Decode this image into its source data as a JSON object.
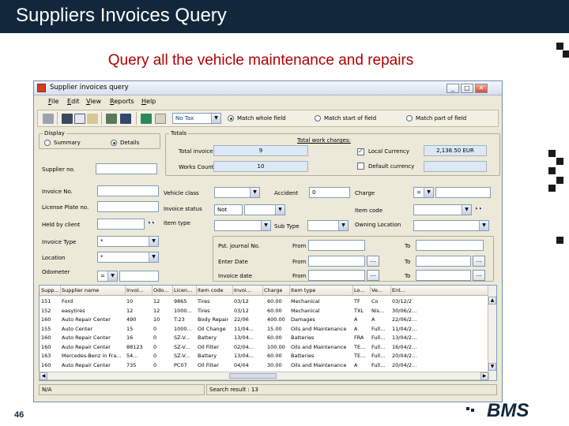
{
  "slide": {
    "title": "Suppliers Invoices Query",
    "subtitle": "Query all the vehicle maintenance and repairs",
    "page_number": "46",
    "logo_text": "BMS"
  },
  "window": {
    "title": "Supplier invoices query",
    "controls": [
      "_",
      "□",
      "✕"
    ],
    "menu": [
      "File",
      "Edit",
      "View",
      "Reports",
      "Help"
    ]
  },
  "toolbar": {
    "tax_combo": "No Tax",
    "radios": [
      {
        "label": "Match whole field",
        "checked": true
      },
      {
        "label": "Match start of field",
        "checked": false
      },
      {
        "label": "Match part of field",
        "checked": false
      }
    ]
  },
  "display": {
    "legend": "Display",
    "summary_label": "Summary",
    "detail_label": "Details",
    "selected": "Details"
  },
  "totals": {
    "legend": "Totals",
    "total_invoice_label": "Total invoice",
    "total_invoice_value": "9",
    "works_count_label": "Works Count",
    "works_count_value": "10",
    "total_work_charges_label": "Total work charges:",
    "local_currency_label": "Local Currency",
    "local_currency_checked": true,
    "local_currency_value": "2,138.50 EUR",
    "default_currency_label": "Default currency",
    "default_currency_checked": false
  },
  "filters": {
    "supplier_no": "Supplier no.",
    "invoice_no": "Invoice No.",
    "license_plate_no": "License Plate no.",
    "held_by_client": "Held by client",
    "invoice_type": "Invoice Type",
    "invoice_type_value": "*",
    "location": "Location",
    "location_value": "*",
    "odometer": "Odometer",
    "odometer_op": "=",
    "vehicle_class": "Vehicle class",
    "invoice_status": "Invoice status",
    "invoice_status_value": "Not",
    "item_type": "Item type",
    "sub_type": "Sub Type",
    "accident": "Accident",
    "accident_value": "0",
    "charge": "Charge",
    "charge_op": "=",
    "item_code": "Item code",
    "owning_location": "Owning Location",
    "pst_journal_no": "Pst. journal No.",
    "enter_date": "Enter Date",
    "invoice_date": "Invoice date",
    "from": "From",
    "to": "To",
    "ellipsis": "..."
  },
  "grid": {
    "columns": [
      "Supp...",
      "Supplier name",
      "Invoi...",
      "Odo...",
      "Licen...",
      "Item code",
      "Invoi...",
      "Charge",
      "Item type",
      "Lo...",
      "Ve...",
      "Ent..."
    ],
    "rows": [
      [
        "151",
        "Ford",
        "10",
        "12",
        "9865",
        "Tires",
        "03/12",
        "60.00",
        "Mechanical",
        "TF",
        "Co",
        "03/12/2"
      ],
      [
        "152",
        "easytires",
        "12",
        "12",
        "1000...",
        "Tires",
        "03/12",
        "60.00",
        "Mechanical",
        "TXL",
        "Nis...",
        "30/06/2..."
      ],
      [
        "160",
        "Auto Repair Center",
        "490",
        "10",
        "T:23",
        "Body Repair",
        "22/06",
        "400.00",
        "Damages",
        "A",
        "A",
        "22/06/2..."
      ],
      [
        "155",
        "Auto Center",
        "15",
        "0",
        "1000...",
        "Oil Change",
        "11/04...",
        "15.00",
        "Oils and Maintenance",
        "A",
        "Full...",
        "11/04/2..."
      ],
      [
        "160",
        "Auto Repair Center",
        "16",
        "0",
        "SZ-V...",
        "Battery",
        "13/04...",
        "60.00",
        "Batteries",
        "FRA",
        "Full...",
        "13/04/2..."
      ],
      [
        "160",
        "Auto Repair Center",
        "88123",
        "0",
        "SZ-V...",
        "Oil Filter",
        "02/04...",
        "100.00",
        "Oils and Maintenance",
        "TE...",
        "Full...",
        "16/04/2..."
      ],
      [
        "163",
        "Mercedes-Benz in Fra...",
        "54...",
        "0",
        "SZ-V...",
        "Battery",
        "13/04...",
        "60.00",
        "Batteries",
        "TE...",
        "Full...",
        "20/04/2..."
      ],
      [
        "160",
        "Auto Repair Center",
        "735",
        "0",
        "PC07",
        "Oil Filter",
        "04/04",
        "30.00",
        "Oils and Maintenance",
        "A",
        "Full...",
        "20/04/2..."
      ]
    ]
  },
  "status": {
    "left": "N/A",
    "search_result": "Search result : 13"
  }
}
